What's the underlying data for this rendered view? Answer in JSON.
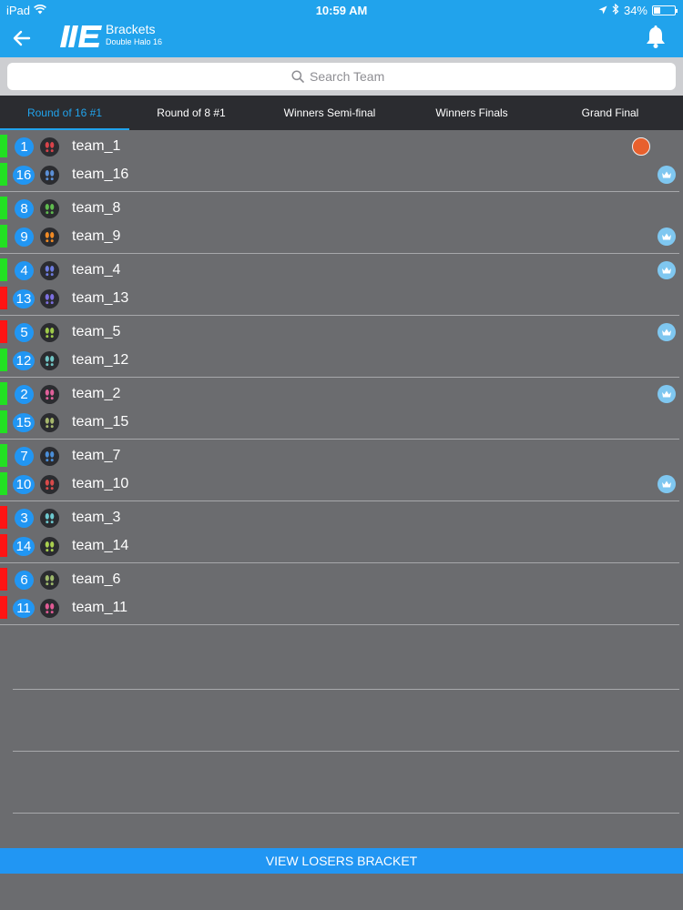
{
  "status_bar": {
    "device": "iPad",
    "time": "10:59 AM",
    "battery": "34%",
    "battery_level": 0.34
  },
  "nav": {
    "title": "Brackets",
    "subtitle": "Double Halo 16",
    "back_icon": "arrow-left-icon",
    "bell_icon": "bell-icon"
  },
  "search": {
    "placeholder": "Search Team"
  },
  "tabs": [
    {
      "label": "Round of 16 #1",
      "active": true
    },
    {
      "label": "Round of 8 #1",
      "active": false
    },
    {
      "label": "Winners Semi-final",
      "active": false
    },
    {
      "label": "Winners Finals",
      "active": false
    },
    {
      "label": "Grand Final",
      "active": false
    }
  ],
  "colors": {
    "accent": "#21a3ec",
    "seed_badge": "#2196f3",
    "win_bar": "#22e022",
    "loss_bar": "#ff1414",
    "crown_badge": "#7fc7f0",
    "pending_dot": "#e8602d"
  },
  "matches": [
    {
      "teams": [
        {
          "seed": "1",
          "name": "team_1",
          "bar": "win",
          "avatar_color": "#d8434a",
          "marker": "pending"
        },
        {
          "seed": "16",
          "name": "team_16",
          "bar": "win",
          "avatar_color": "#5b8fd6",
          "marker": "crown"
        }
      ]
    },
    {
      "teams": [
        {
          "seed": "8",
          "name": "team_8",
          "bar": "win",
          "avatar_color": "#5fbb4e",
          "marker": ""
        },
        {
          "seed": "9",
          "name": "team_9",
          "bar": "win",
          "avatar_color": "#f08a24",
          "marker": "crown"
        }
      ]
    },
    {
      "teams": [
        {
          "seed": "4",
          "name": "team_4",
          "bar": "win",
          "avatar_color": "#6d7ce0",
          "marker": "crown"
        },
        {
          "seed": "13",
          "name": "team_13",
          "bar": "loss",
          "avatar_color": "#7c6fe0",
          "marker": ""
        }
      ]
    },
    {
      "teams": [
        {
          "seed": "5",
          "name": "team_5",
          "bar": "loss",
          "avatar_color": "#9ec94a",
          "marker": "crown"
        },
        {
          "seed": "12",
          "name": "team_12",
          "bar": "win",
          "avatar_color": "#6fc4c4",
          "marker": ""
        }
      ]
    },
    {
      "teams": [
        {
          "seed": "2",
          "name": "team_2",
          "bar": "win",
          "avatar_color": "#e0609a",
          "marker": "crown"
        },
        {
          "seed": "15",
          "name": "team_15",
          "bar": "win",
          "avatar_color": "#a6b66c",
          "marker": ""
        }
      ]
    },
    {
      "teams": [
        {
          "seed": "7",
          "name": "team_7",
          "bar": "win",
          "avatar_color": "#4a8ed8",
          "marker": ""
        },
        {
          "seed": "10",
          "name": "team_10",
          "bar": "win",
          "avatar_color": "#d84a4a",
          "marker": "crown"
        }
      ]
    },
    {
      "teams": [
        {
          "seed": "3",
          "name": "team_3",
          "bar": "loss",
          "avatar_color": "#6cc8cf",
          "marker": ""
        },
        {
          "seed": "14",
          "name": "team_14",
          "bar": "loss",
          "avatar_color": "#a9cf4f",
          "marker": ""
        }
      ]
    },
    {
      "teams": [
        {
          "seed": "6",
          "name": "team_6",
          "bar": "loss",
          "avatar_color": "#9db86a",
          "marker": ""
        },
        {
          "seed": "11",
          "name": "team_11",
          "bar": "loss",
          "avatar_color": "#e05a94",
          "marker": ""
        }
      ]
    }
  ],
  "footer": {
    "button_label": "VIEW LOSERS BRACKET"
  }
}
